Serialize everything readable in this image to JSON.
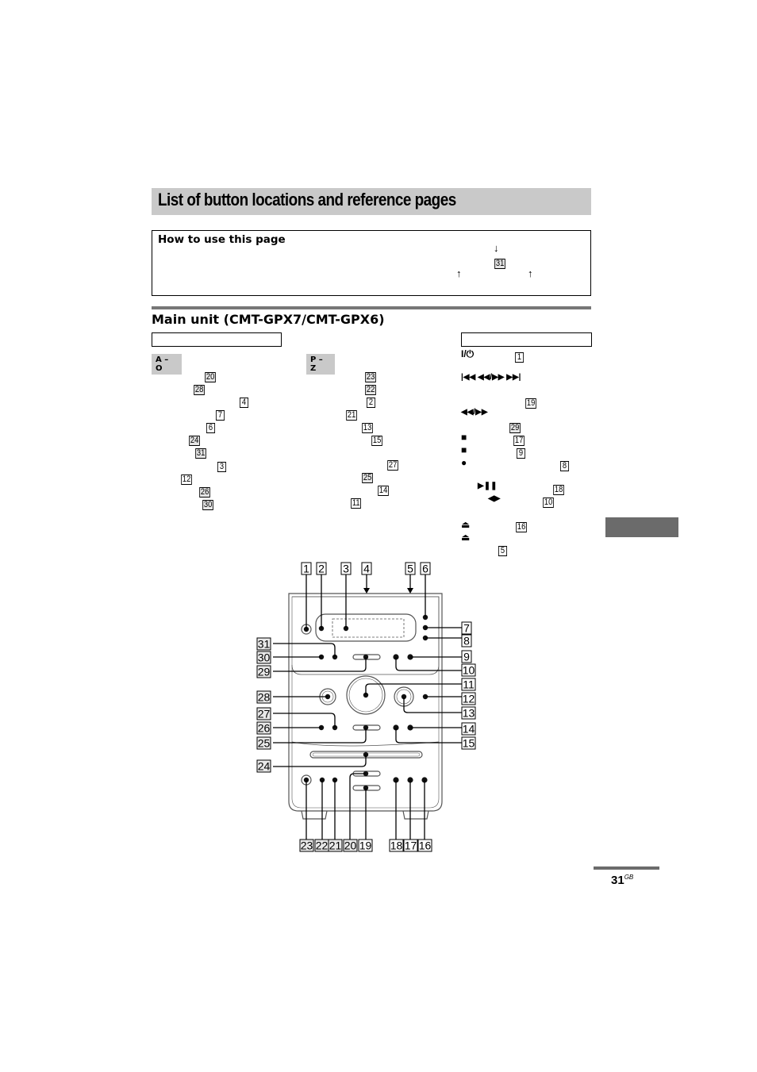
{
  "page": {
    "title": "List of button locations and reference pages",
    "page_number": "31",
    "page_suffix": "GB"
  },
  "howto": {
    "title": "How to use this page",
    "example_ref": "31"
  },
  "section": {
    "title": "Main unit (CMT-GPX7/CMT-GPX6)"
  },
  "alpha_index": {
    "a_o": {
      "label": "A – O",
      "refs": [
        "20",
        "28",
        "4",
        "7",
        "6",
        "24",
        "31",
        "3",
        "12",
        "26",
        "30"
      ]
    },
    "p_z": {
      "label": "P – Z",
      "refs": [
        "23",
        "22",
        "2",
        "21",
        "13",
        "15",
        "27",
        "25",
        "14",
        "11"
      ]
    }
  },
  "symbol_index": {
    "items": [
      {
        "symbol": "I/⏻",
        "ref": "1"
      },
      {
        "symbol": "|◀◀ ◀◀/▶▶ ▶▶|",
        "ref": ""
      },
      {
        "symbol": "",
        "ref": "19"
      },
      {
        "symbol": "◀◀/▶▶",
        "ref": ""
      },
      {
        "symbol": "",
        "ref": "29"
      },
      {
        "symbol": "■",
        "ref": "17"
      },
      {
        "symbol": "■",
        "ref": "9"
      },
      {
        "symbol": "●",
        "ref": "8"
      },
      {
        "symbol": "▶❚❚",
        "ref": "18"
      },
      {
        "symbol": "◀▶",
        "ref": "10"
      },
      {
        "symbol": "⏏",
        "ref": "16"
      },
      {
        "symbol": "⏏",
        "ref": ""
      },
      {
        "symbol": "",
        "ref": "5"
      }
    ]
  },
  "diagram": {
    "top_labels": [
      "1",
      "2",
      "3",
      "4",
      "5",
      "6"
    ],
    "right_labels": [
      "7",
      "8",
      "9",
      "10",
      "11",
      "12",
      "13",
      "14",
      "15"
    ],
    "left_labels": [
      "31",
      "30",
      "29",
      "28",
      "27",
      "26",
      "25",
      "24"
    ],
    "bottom_labels": [
      "23",
      "22",
      "21",
      "20",
      "19",
      "18",
      "17",
      "16"
    ]
  }
}
